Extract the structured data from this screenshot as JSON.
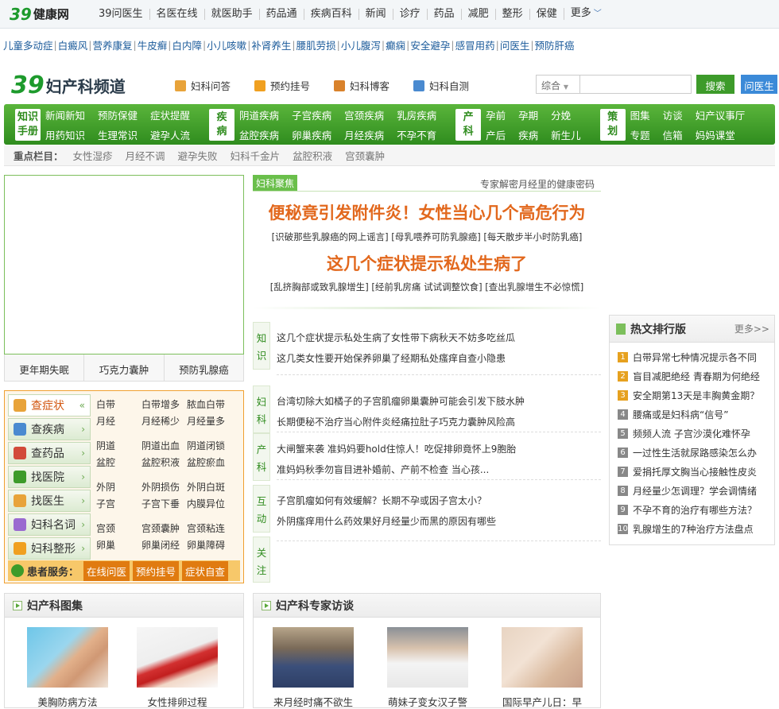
{
  "topbar": {
    "logo_number": "39",
    "logo_text": "健康网",
    "nav": [
      "39问医生",
      "名医在线",
      "就医助手",
      "药品通",
      "疾病百科",
      "新闻",
      "诊疗",
      "药品",
      "减肥",
      "整形",
      "保健",
      "更多"
    ]
  },
  "quick_links": [
    "儿童多动症",
    "白癜风",
    "营养康复",
    "牛皮癣",
    "白内障",
    "小儿咳嗽",
    "补肾养生",
    "腰肌劳损",
    "小儿腹泻",
    "癫痫",
    "安全避孕",
    "感冒用药",
    "问医生",
    "预防肝癌"
  ],
  "channel": {
    "logo_number": "39",
    "logo_text": "妇产科频道",
    "links": [
      "妇科问答",
      "预约挂号",
      "妇科博客",
      "妇科自测"
    ],
    "search": {
      "select_value": "综合",
      "placeholder": "",
      "search_btn": "搜索",
      "ask_btn": "问医生"
    },
    "colors": {
      "green": "#3d9b2a",
      "blue": "#3b8ad8",
      "orange": "#e2681d"
    }
  },
  "green_nav": [
    {
      "tag": [
        "知识",
        "手册"
      ],
      "items": [
        "新闻新知",
        "预防保健",
        "症状提醒",
        "用药知识",
        "生理常识",
        "避孕人流"
      ]
    },
    {
      "tag": [
        "疾",
        "病"
      ],
      "items": [
        "阴道疾病",
        "子宫疾病",
        "宫颈疾病",
        "乳房疾病",
        "盆腔疾病",
        "卵巢疾病",
        "月经疾病",
        "不孕不育"
      ]
    },
    {
      "tag": [
        "产",
        "科"
      ],
      "items": [
        "孕前",
        "孕期",
        "分娩",
        "产后",
        "疾病",
        "新生儿"
      ]
    },
    {
      "tag": [
        "策",
        "划"
      ],
      "items": [
        "图集",
        "访谈",
        "妇产议事厅",
        "专题",
        "信箱",
        "妈妈课堂"
      ]
    }
  ],
  "key_columns": {
    "label": "重点栏目：",
    "items": [
      "女性湿疹",
      "月经不调",
      "避孕失败",
      "妇科千金片",
      "盆腔积液",
      "宫颈囊肿"
    ]
  },
  "slider_tabs": [
    "更年期失眠",
    "巧克力囊肿",
    "预防乳腺癌"
  ],
  "tools": {
    "buttons": [
      "查症状",
      "查疾病",
      "查药品",
      "找医院",
      "找医生",
      "妇科名词",
      "妇科整形"
    ],
    "grid": [
      [
        "白带",
        "白带增多",
        "脓血白带",
        "月经",
        "月经稀少",
        "月经量多"
      ],
      [
        "阴道",
        "阴道出血",
        "阴道闭锁",
        "盆腔",
        "盆腔积液",
        "盆腔瘀血"
      ],
      [
        "外阴",
        "外阴损伤",
        "外阴白斑",
        "子宫",
        "子宫下垂",
        "内膜异位"
      ],
      [
        "宫颈",
        "宫颈囊肿",
        "宫颈粘连",
        "卵巢",
        "卵巢闭经",
        "卵巢障碍"
      ]
    ],
    "service_label": "患者服务：",
    "service_buttons": [
      "在线问医",
      "预约挂号",
      "症状自查"
    ]
  },
  "focus": {
    "tag": "妇科聚焦",
    "subtitle": "专家解密月经里的健康密码",
    "headline1": "便秘竟引发附件炎！女性当心几个高危行为",
    "subs1": "[识破那些乳腺癌的网上谣言] [母乳喂养可防乳腺癌] [每天散步半小时防乳癌]",
    "headline2": "这几个症状提示私处生病了",
    "subs2": "[乱挤胸部或致乳腺增生] [经前乳房痛 试试调整饮食] [查出乳腺增生不必惊慌]"
  },
  "sections": [
    {
      "tag": [
        "知",
        "识"
      ],
      "rows": [
        [
          "这几个症状提示私处生病了",
          "女性带下病秋天不妨多吃丝瓜"
        ],
        [
          "这几类女性要开始保养卵巢了",
          "经期私处瘙痒自查小隐患"
        ]
      ]
    },
    {
      "tag": [
        "妇",
        "科"
      ],
      "rows": [
        [
          "台湾切除大如橘子的子宫肌瘤",
          "卵巢囊肿可能会引发下肢水肿"
        ],
        [
          "长期便秘不治疗当心附件炎",
          "经痛拉肚子巧克力囊肿风险高"
        ]
      ]
    },
    {
      "tag": [
        "产",
        "科"
      ],
      "rows": [
        [
          "大闸蟹来袭 准妈妈要hold住",
          "惊人！吃促排卵竟怀上9胞胎"
        ],
        [
          "准妈妈秋季勿盲目进补",
          "婚前、产前不检查 当心孩..."
        ]
      ]
    },
    {
      "tag": [
        "互",
        "动"
      ],
      "rows": [
        [
          "子宫肌瘤如何有效缓解？",
          "长期不孕或因子宫太小？"
        ],
        [
          "外阴瘙痒用什么药效果好",
          "月经量少而黑的原因有哪些"
        ]
      ]
    },
    {
      "tag": [
        "关",
        "注"
      ],
      "rows": []
    }
  ],
  "hot": {
    "title": "热文排行版",
    "more": "更多>>",
    "items": [
      "白带异常七种情况提示各不同",
      "盲目减肥绝经 青春期为何绝经",
      "安全期第13天是丰胸黄金期？",
      "腰痛或是妇科病“信号”",
      "频频人流 子宫沙漠化难怀孕",
      "一过性生活就尿路感染怎么办",
      "爱捐托厚文胸当心接触性皮炎",
      "月经量少怎调理？学会调情绪",
      "不孕不育的治疗有哪些方法？",
      "乳腺增生的7种治疗方法盘点"
    ]
  },
  "gallery": {
    "title": "妇产科图集",
    "items": [
      "美胸防病方法",
      "女性排卵过程"
    ]
  },
  "interviews": {
    "title": "妇产科专家访谈",
    "items": [
      "来月经时痛不欲生",
      "萌妹子变女汉子警",
      "国际早产儿日：早"
    ]
  }
}
